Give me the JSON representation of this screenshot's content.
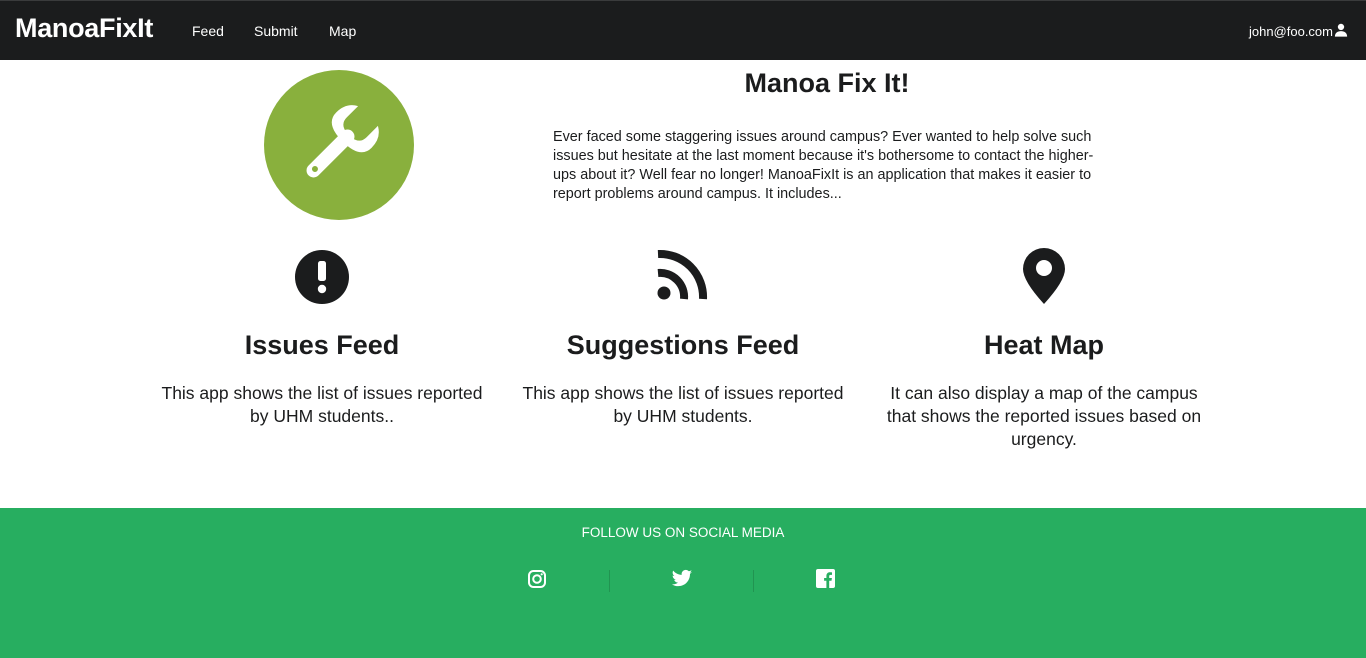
{
  "navbar": {
    "brand": "ManoaFixIt",
    "links": [
      {
        "label": "Feed"
      },
      {
        "label": "Submit"
      },
      {
        "label": "Map"
      }
    ],
    "user": {
      "email": "john@foo.com",
      "icon": "user-icon"
    }
  },
  "hero": {
    "logo_icon": "wrench-icon",
    "logo_color": "#89b03d",
    "title": "Manoa Fix It!",
    "text": "Ever faced some staggering issues around campus? Ever wanted to help solve such issues but hesitate at the last moment because it's bothersome to contact the higher-ups about it? Well fear no longer! ManoaFixIt is an application that makes it easier to report problems around campus. It includes..."
  },
  "features": [
    {
      "icon": "exclamation-circle-icon",
      "title": "Issues Feed",
      "description": "This app shows the list of issues reported by UHM students.."
    },
    {
      "icon": "rss-icon",
      "title": "Suggestions Feed",
      "description": "This app shows the list of issues reported by UHM students."
    },
    {
      "icon": "map-marker-icon",
      "title": "Heat Map",
      "description": "It can also display a map of the campus that shows the reported issues based on urgency."
    }
  ],
  "footer": {
    "title": "FOLLOW US ON SOCIAL MEDIA",
    "background": "#27ae60",
    "social": [
      {
        "icon": "instagram-icon"
      },
      {
        "icon": "twitter-icon"
      },
      {
        "icon": "facebook-icon"
      }
    ]
  }
}
